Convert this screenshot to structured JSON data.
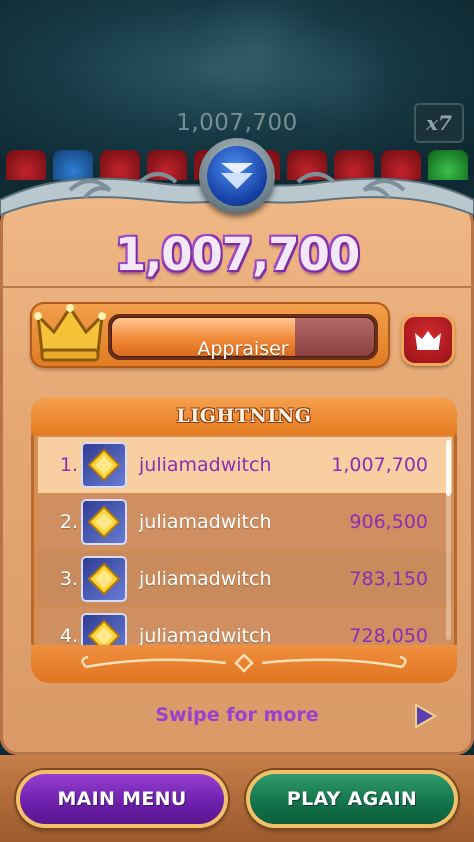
{
  "game": {
    "background_score": "1,007,700",
    "multiplier": "x7"
  },
  "results": {
    "final_score": "1,007,700",
    "rank_title": "Appraiser",
    "rank_progress_percent": 70
  },
  "leaderboard": {
    "title": "LIGHTNING",
    "rows": [
      {
        "rank": "1.",
        "name": "juliamadwitch",
        "score": "1,007,700"
      },
      {
        "rank": "2.",
        "name": "juliamadwitch",
        "score": "906,500"
      },
      {
        "rank": "3.",
        "name": "juliamadwitch",
        "score": "783,150"
      },
      {
        "rank": "4.",
        "name": "juliamadwitch",
        "score": "728,050"
      }
    ]
  },
  "swipe": {
    "label": "Swipe for more"
  },
  "buttons": {
    "main_menu": "MAIN MENU",
    "play_again": "PLAY AGAIN"
  },
  "icons": {
    "badge": "chevron-down-icon",
    "crown": "crown-icon",
    "rank_button": "crown-icon",
    "avatar": "yellow-gem-icon",
    "swipe": "play-arrow-icon"
  },
  "colors": {
    "score_purple": "#8a2fb5",
    "panel": "#e5a874",
    "main_menu_button": "#6b1ea9",
    "play_again_button": "#127049"
  }
}
